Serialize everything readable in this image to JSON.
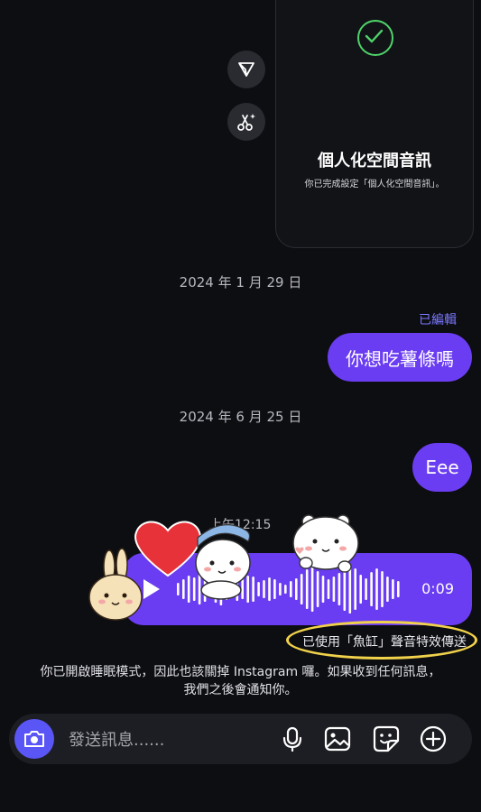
{
  "card": {
    "title": "個人化空間音訊",
    "subtitle": "你已完成設定「個人化空間音訊」。"
  },
  "dates": {
    "first": "2024 年 1 月 29 日",
    "second": "2024 年 6 月 25 日"
  },
  "messages": {
    "edited_label": "已編輯",
    "bubble1": "你想吃薯條嗎",
    "bubble2": "Eee",
    "voice_time": "上午12:15",
    "voice_duration": "0:09",
    "effect_note": "已使用「魚缸」聲音特效傳送"
  },
  "sleep_note": {
    "line1": "你已開啟睡眠模式，因此也該關掉 Instagram 囉。如果收到任何訊息，",
    "line2": "我們之後會通知你。"
  },
  "composer": {
    "placeholder": "發送訊息......"
  },
  "colors": {
    "accent": "#6b3df2",
    "camera": "#5a55f5",
    "highlight_ring": "#f1d24b",
    "check": "#4fd36a",
    "heart": "#e8323a"
  },
  "icons": [
    "check-icon",
    "send-icon",
    "scissors-sparkle-icon",
    "play-icon",
    "camera-icon",
    "microphone-icon",
    "gallery-icon",
    "sticker-icon",
    "plus-icon"
  ]
}
